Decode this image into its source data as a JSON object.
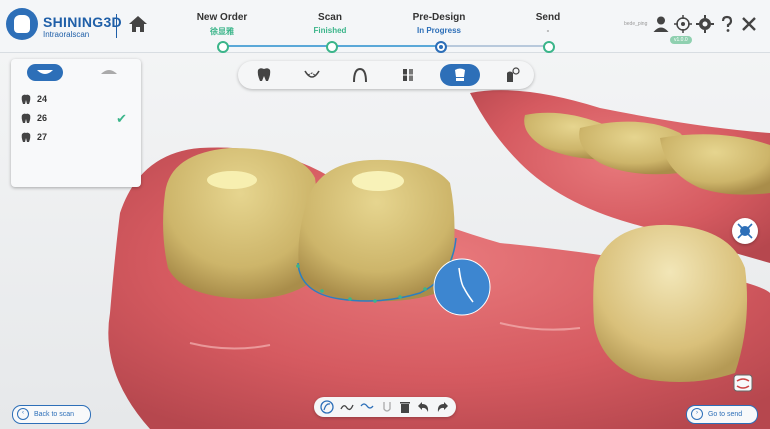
{
  "app": {
    "brand": "SHINING3D",
    "subtitle": "Intraoralscan"
  },
  "steps": [
    {
      "title": "New Order",
      "status": "徐显雅",
      "status_color": "#3bb58a"
    },
    {
      "title": "Scan",
      "status": "Finished",
      "status_color": "#3bb58a"
    },
    {
      "title": "Pre-Design",
      "status": "In Progress",
      "status_color": "#2d6fb8"
    },
    {
      "title": "Send",
      "status": "-",
      "status_color": "#888888"
    }
  ],
  "header": {
    "user": "bede_ping",
    "version": "v1.0.0",
    "icons": [
      "user-icon",
      "crosshair-icon",
      "gear-icon",
      "help-icon",
      "close-icon"
    ]
  },
  "toolbar": {
    "tools": [
      "tooth-icon",
      "margin-line-icon",
      "arch-icon",
      "adjust-icon",
      "crown-icon",
      "insertion-icon"
    ],
    "active": 4
  },
  "teeth_panel": {
    "tabs": [
      "upper-jaw-icon",
      "lower-jaw-icon"
    ],
    "active_tab": 0,
    "teeth": [
      {
        "num": "24",
        "checked": false
      },
      {
        "num": "26",
        "checked": true
      },
      {
        "num": "27",
        "checked": false
      }
    ]
  },
  "footer": {
    "back_label": "Back to scan",
    "next_label": "Go to send",
    "tools": [
      "curve-icon",
      "freehand-icon",
      "smooth-icon",
      "cut-icon",
      "delete-icon",
      "undo-icon",
      "redo-icon"
    ]
  },
  "colors": {
    "accent": "#2d6fb8",
    "success": "#3bb58a",
    "gum": "#d85a5e",
    "tooth": "#d8c47a"
  }
}
